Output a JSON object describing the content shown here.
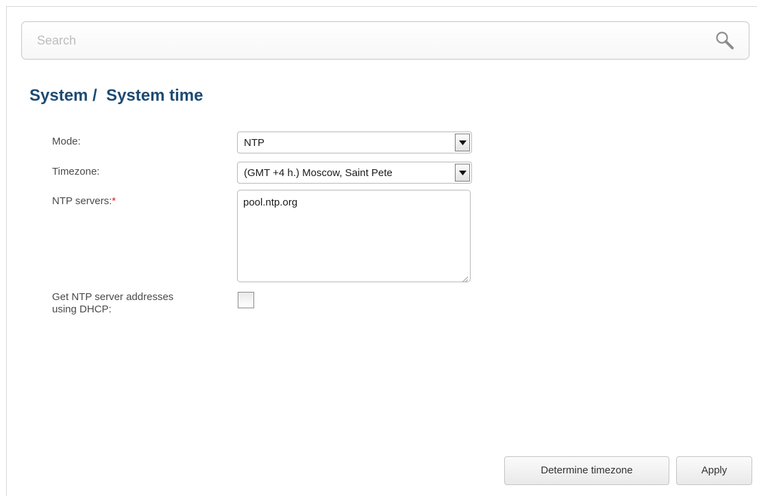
{
  "search": {
    "placeholder": "Search",
    "icon": "search-icon"
  },
  "page_title": "System /  System time",
  "form": {
    "mode": {
      "label": "Mode:",
      "value": "NTP"
    },
    "timezone": {
      "label": "Timezone:",
      "value": "(GMT +4 h.) Moscow, Saint Pete"
    },
    "ntp_servers": {
      "label": "NTP servers:",
      "required_mark": "*",
      "value": "pool.ntp.org"
    },
    "dhcp": {
      "label_line1": "Get NTP server addresses",
      "label_line2": "using DHCP:",
      "checked": false
    }
  },
  "buttons": {
    "determine_timezone": "Determine timezone",
    "apply": "Apply"
  },
  "colors": {
    "title": "#1d4a72",
    "required": "#d62020",
    "label": "#4a4a4a"
  }
}
